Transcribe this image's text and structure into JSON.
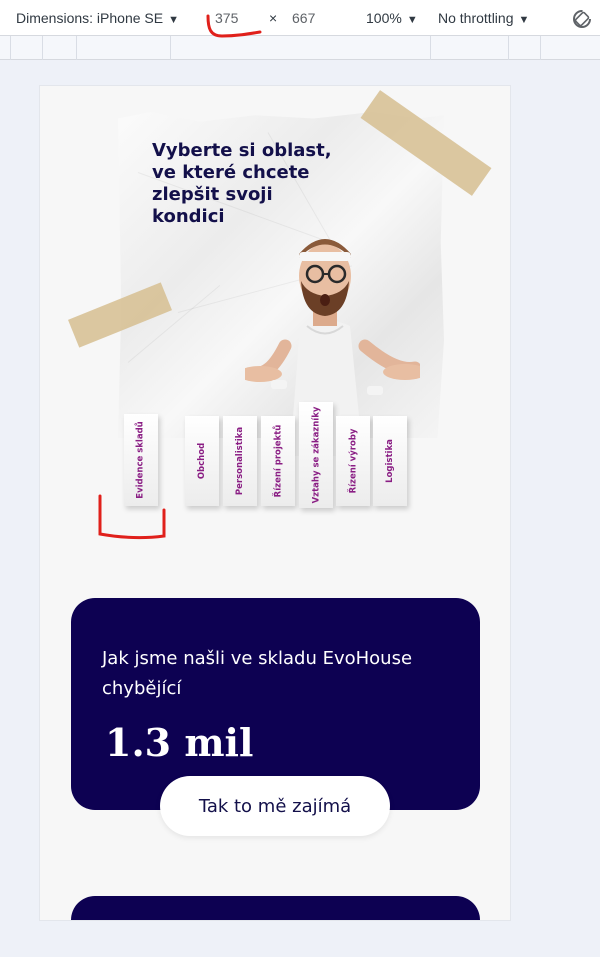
{
  "devtools": {
    "device_label": "Dimensions: iPhone SE",
    "width": "375",
    "separator": "×",
    "height": "667",
    "zoom": "100%",
    "throttling": "No throttling"
  },
  "hero": {
    "headline": "Vyberte si oblast, ve které chcete zlepšit svoji kondici",
    "tabs": [
      "Evidence skladů",
      "Obchod",
      "Personalistika",
      "Řízení projektů",
      "Vztahy se zákazníky",
      "Řízení výroby",
      "Logistika"
    ]
  },
  "stat_card": {
    "text": "Jak jsme našli ve skladu EvoHouse chybějící",
    "value": "1.3 mil",
    "cta_label": "Tak to mě zajímá"
  },
  "colors": {
    "navy": "#0d0152",
    "tab_text": "#8a1e84",
    "annotation_red": "#e0201b"
  }
}
